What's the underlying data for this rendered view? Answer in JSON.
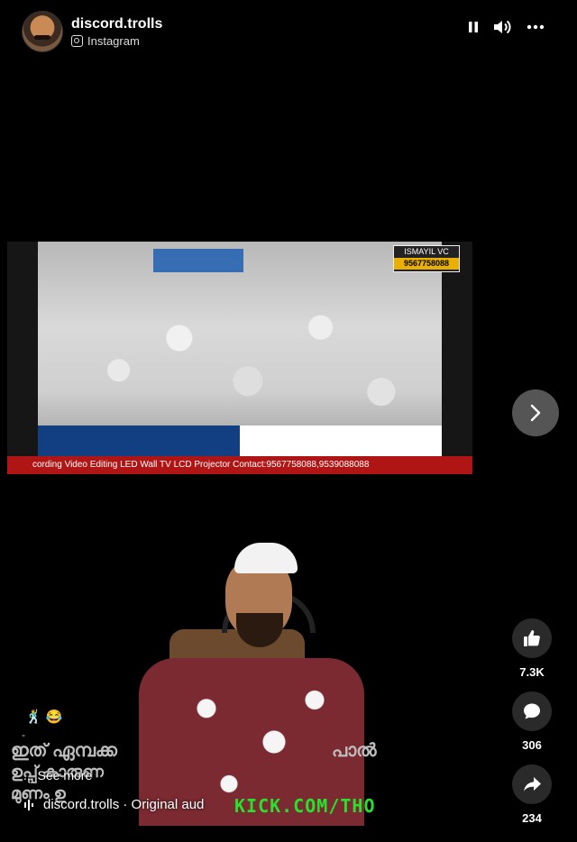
{
  "header": {
    "username": "discord.trolls",
    "source": "Instagram"
  },
  "controls": {
    "pause_icon": "pause-icon",
    "volume_icon": "volume-icon",
    "more_icon": "more-icon"
  },
  "video_top": {
    "badge_name": "ISMAYIL VC",
    "badge_number": "9567758088",
    "watermark": "ISMAYIL VC",
    "ticker": "cording   Video Editing   LED Wall   TV   LCD Projector   Contact:9567758088,9539088088"
  },
  "video_bottom": {
    "overlay_text": "KICK.COM/THO",
    "subtitle_line1_left": "ഇത് ഏമ്പക്ക",
    "subtitle_line1_right": "പാൽ",
    "subtitle_line2": "ഉപ്പ് കാരുണ",
    "subtitle_line3": "മുണം ഉ"
  },
  "navigation": {
    "next_icon": "chevron-right-icon"
  },
  "actions": [
    {
      "icon": "thumbs-up-icon",
      "count": "7.3K"
    },
    {
      "icon": "comment-icon",
      "count": "306"
    },
    {
      "icon": "share-icon",
      "count": "234"
    }
  ],
  "caption": {
    "emojis": "🕺 😂",
    "dash": "-",
    "see_more": "... See more"
  },
  "audio": {
    "label": "discord.trolls · Original aud"
  }
}
